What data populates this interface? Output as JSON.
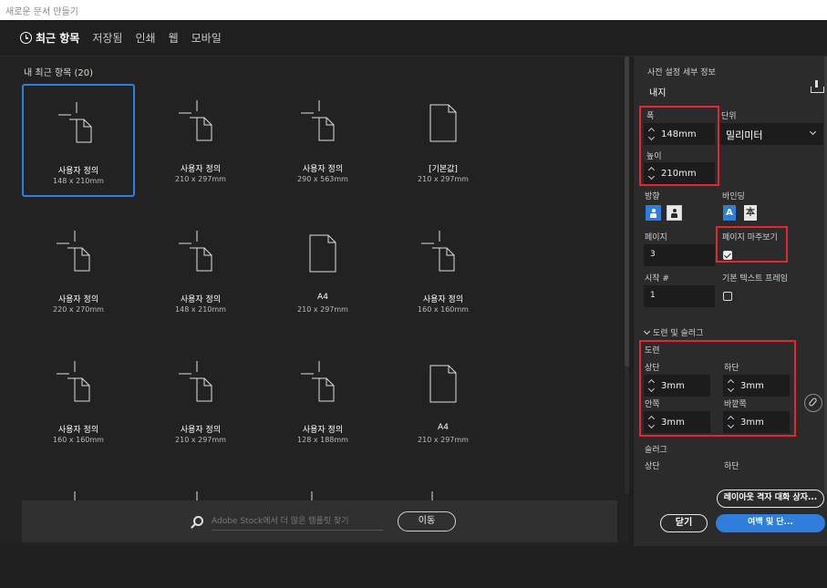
{
  "window": {
    "title": "새로운 문서 만들기"
  },
  "tabs": [
    {
      "label": "최근 항목",
      "active": true,
      "icon": "clock-icon"
    },
    {
      "label": "저장됨"
    },
    {
      "label": "인쇄"
    },
    {
      "label": "웹"
    },
    {
      "label": "모바일"
    }
  ],
  "recent": {
    "heading": "내 최근 항목 (20)",
    "items": [
      {
        "name": "사용자 정의",
        "size": "148 x 210mm",
        "icon": "custom-document-icon",
        "selected": true
      },
      {
        "name": "사용자 정의",
        "size": "210 x 297mm",
        "icon": "custom-document-icon"
      },
      {
        "name": "사용자 정의",
        "size": "290 x 563mm",
        "icon": "custom-document-icon"
      },
      {
        "name": "[기본값]",
        "size": "210 x 297mm",
        "icon": "document-icon"
      },
      {
        "name": "사용자 정의",
        "size": "220 x 270mm",
        "icon": "custom-document-icon"
      },
      {
        "name": "사용자 정의",
        "size": "148 x 210mm",
        "icon": "custom-document-icon"
      },
      {
        "name": "A4",
        "size": "210 x 297mm",
        "icon": "document-icon"
      },
      {
        "name": "사용자 정의",
        "size": "160 x 160mm",
        "icon": "custom-document-icon"
      },
      {
        "name": "사용자 정의",
        "size": "160 x 160mm",
        "icon": "custom-document-icon"
      },
      {
        "name": "사용자 정의",
        "size": "210 x 297mm",
        "icon": "custom-document-icon"
      },
      {
        "name": "사용자 정의",
        "size": "128 x 188mm",
        "icon": "custom-document-icon"
      },
      {
        "name": "A4",
        "size": "210 x 297mm",
        "icon": "document-icon"
      },
      {
        "name": "",
        "size": "",
        "icon": "custom-document-icon"
      },
      {
        "name": "",
        "size": "",
        "icon": "custom-document-icon"
      },
      {
        "name": "",
        "size": "",
        "icon": "custom-wide-document-icon"
      },
      {
        "name": "",
        "size": "",
        "icon": "custom-wide-document-icon"
      }
    ]
  },
  "search": {
    "placeholder": "Adobe Stock에서 더 많은 템플릿 찾기",
    "go_label": "이동"
  },
  "preset": {
    "heading": "사전 설정 세부 정보",
    "name": "내지",
    "width_label": "폭",
    "width_value": "148mm",
    "units_label": "단위",
    "units_value": "밀리미터",
    "height_label": "높이",
    "height_value": "210mm",
    "orientation_label": "방향",
    "binding_label": "바인딩",
    "binding_left": "A",
    "binding_right": "本",
    "pages_label": "페이지",
    "pages_value": "3",
    "facing_label": "페이지 마주보기",
    "facing_checked": true,
    "start_label": "시작 #",
    "start_value": "1",
    "primary_frame_label": "기본 텍스트 프레임",
    "primary_frame_checked": false
  },
  "bleed_slug": {
    "section_label": "도련 및 슬러그",
    "bleed_label": "도련",
    "top_label": "상단",
    "top_value": "3mm",
    "bottom_label": "하단",
    "bottom_value": "3mm",
    "inside_label": "안쪽",
    "inside_value": "3mm",
    "outside_label": "바깥쪽",
    "outside_value": "3mm",
    "slug_label": "슬러그",
    "slug_top_label": "상단",
    "slug_bottom_label": "하단"
  },
  "actions": {
    "layout_grid": "레이아웃 격자 대화 상자...",
    "close": "닫기",
    "margins": "여백 및 단..."
  },
  "colors": {
    "accent": "#2f7ddc",
    "highlight": "#e0282e"
  }
}
